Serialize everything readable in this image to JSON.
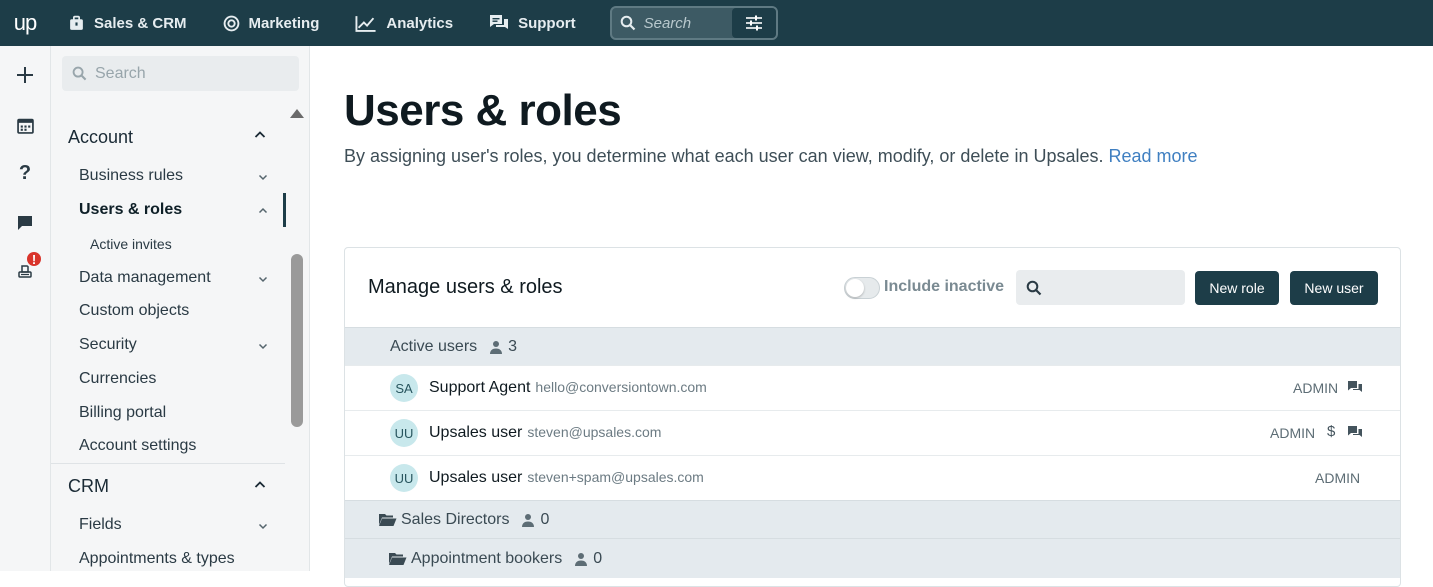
{
  "topnav": {
    "logo": "up",
    "items": [
      {
        "label": "Sales & CRM",
        "icon": "briefcase-icon"
      },
      {
        "label": "Marketing",
        "icon": "target-icon"
      },
      {
        "label": "Analytics",
        "icon": "chart-line-icon"
      },
      {
        "label": "Support",
        "icon": "chat-bubbles-icon"
      }
    ],
    "search_placeholder": "Search"
  },
  "rail": {
    "icons": [
      "plus-icon",
      "calendar-icon",
      "help-icon",
      "chat-icon",
      "notifications-icon"
    ],
    "alert_badge": "!"
  },
  "sidebar": {
    "search_placeholder": "Search",
    "sections": [
      {
        "title": "Account",
        "items": [
          {
            "label": "Business rules",
            "has_chevron": true
          },
          {
            "label": "Users & roles",
            "active": true
          },
          {
            "label": "Active invites",
            "sub": true
          },
          {
            "label": "Data management",
            "has_chevron": true
          },
          {
            "label": "Custom objects"
          },
          {
            "label": "Security",
            "has_chevron": true
          },
          {
            "label": "Currencies"
          },
          {
            "label": "Billing portal"
          },
          {
            "label": "Account settings"
          }
        ]
      },
      {
        "title": "CRM",
        "items": [
          {
            "label": "Fields",
            "has_chevron": true
          },
          {
            "label": "Appointments & types"
          }
        ]
      }
    ]
  },
  "main": {
    "title": "Users & roles",
    "description": "By assigning user's roles, you determine what each user can view, modify, or delete in Upsales.",
    "read_more": "Read more",
    "card": {
      "title": "Manage users & roles",
      "include_inactive_label": "Include inactive",
      "include_inactive": false,
      "new_role_label": "New role",
      "new_user_label": "New user",
      "active_group": {
        "label": "Active users",
        "count": "3"
      },
      "users": [
        {
          "initials": "SA",
          "name": "Support Agent",
          "email": "hello@conversiontown.com",
          "role": "ADMIN",
          "icons": [
            "support-chat-icon"
          ]
        },
        {
          "initials": "UU",
          "name": "Upsales user",
          "email": "steven@upsales.com",
          "role": "ADMIN",
          "icons": [
            "dollar-icon",
            "support-chat-icon"
          ]
        },
        {
          "initials": "UU",
          "name": "Upsales user",
          "email": "steven+spam@upsales.com",
          "role": "ADMIN",
          "icons": []
        }
      ],
      "role_groups": [
        {
          "label": "Sales Directors",
          "count": "0"
        },
        {
          "label": "Appointment bookers",
          "count": "0"
        }
      ]
    }
  },
  "colors": {
    "topbar": "#1d3d48",
    "button": "#1d3d48",
    "link": "#3f7fc1",
    "group_row": "#e4eaee",
    "avatar_bg": "#c8e8ec",
    "alert": "#d9342b"
  }
}
